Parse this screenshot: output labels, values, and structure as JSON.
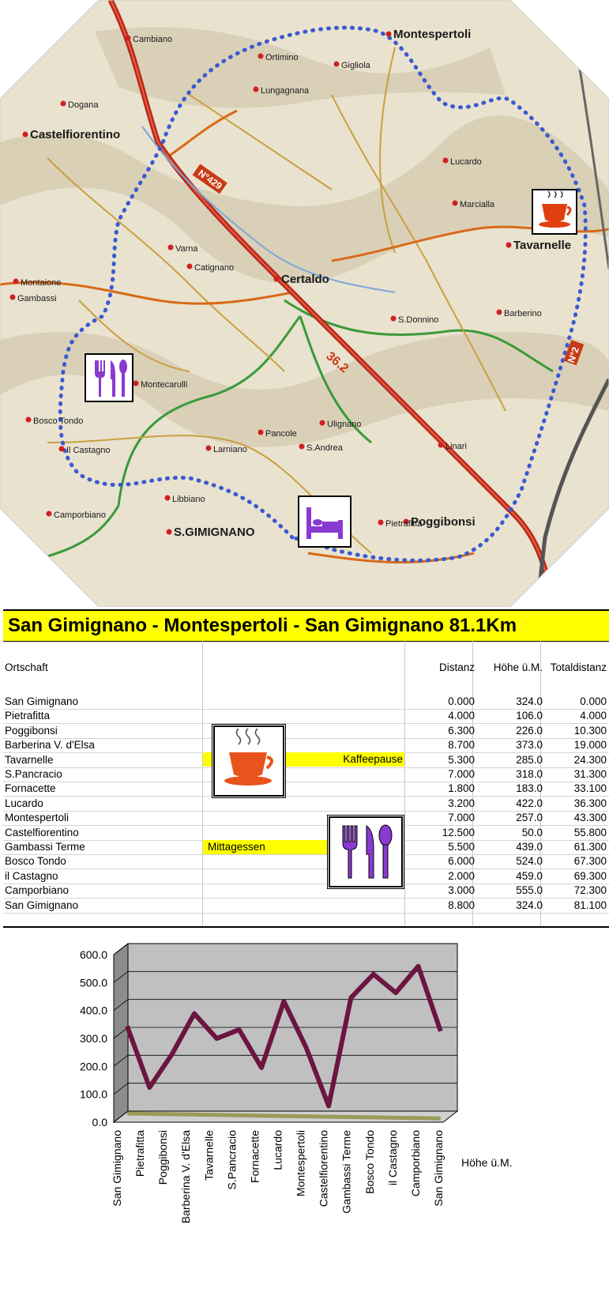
{
  "map": {
    "places": [
      {
        "name": "Castelfiorentino"
      },
      {
        "name": "Montespertoli"
      },
      {
        "name": "Certaldo"
      },
      {
        "name": "Tavarnelle"
      },
      {
        "name": "Poggibonsi"
      },
      {
        "name": "S.GIMIGNANO"
      },
      {
        "name": "Gambassi"
      },
      {
        "name": "Montaione"
      },
      {
        "name": "Barberino"
      },
      {
        "name": "Lucardo"
      },
      {
        "name": "Bosco Tondo"
      },
      {
        "name": "Camporbiano"
      },
      {
        "name": "Pietrafitta"
      },
      {
        "name": "Ortimino"
      },
      {
        "name": "Lungagnana"
      },
      {
        "name": "Gigliola"
      },
      {
        "name": "Varna"
      },
      {
        "name": "Catignano"
      },
      {
        "name": "Larniano"
      },
      {
        "name": "Libbiano"
      },
      {
        "name": "Ulignano"
      },
      {
        "name": "S.Donnino"
      },
      {
        "name": "Marcialla"
      },
      {
        "name": "Linari"
      },
      {
        "name": "Cambiano"
      },
      {
        "name": "Dogana"
      },
      {
        "name": "Il Castagno"
      },
      {
        "name": "Montecarulli"
      },
      {
        "name": "S.Andrea"
      },
      {
        "name": "Pancole"
      }
    ],
    "road_labels": [
      "N°429",
      "36.2",
      "N°2"
    ],
    "icons": {
      "coffee": "coffee-cup-icon",
      "lunch": "cutlery-icon",
      "bed": "bed-icon"
    }
  },
  "title": "San Gimignano - Montespertoli - San Gimignano 81.1Km",
  "table": {
    "headers": {
      "place": "Ortschaft",
      "dist": "Distanz",
      "height": "Höhe ü.M.",
      "total": "Totaldistanz"
    },
    "rows": [
      {
        "name": "San Gimignano",
        "dist": "0.000",
        "h": "324.0",
        "total": "0.000"
      },
      {
        "name": "Pietrafitta",
        "dist": "4.000",
        "h": "106.0",
        "total": "4.000"
      },
      {
        "name": "Poggibonsi",
        "dist": "6.300",
        "h": "226.0",
        "total": "10.300"
      },
      {
        "name": "Barberina V. d'Elsa",
        "dist": "8.700",
        "h": "373.0",
        "total": "19.000"
      },
      {
        "name": "Tavarnelle",
        "dist": "5.300",
        "h": "285.0",
        "total": "24.300"
      },
      {
        "name": "S.Pancracio",
        "dist": "7.000",
        "h": "318.0",
        "total": "31.300"
      },
      {
        "name": "Fornacette",
        "dist": "1.800",
        "h": "183.0",
        "total": "33.100"
      },
      {
        "name": "Lucardo",
        "dist": "3.200",
        "h": "422.0",
        "total": "36.300"
      },
      {
        "name": "Montespertoli",
        "dist": "7.000",
        "h": "257.0",
        "total": "43.300"
      },
      {
        "name": "Castelfiorentino",
        "dist": "12.500",
        "h": "50.0",
        "total": "55.800"
      },
      {
        "name": "Gambassi Terme",
        "dist": "5.500",
        "h": "439.0",
        "total": "61.300"
      },
      {
        "name": "Bosco Tondo",
        "dist": "6.000",
        "h": "524.0",
        "total": "67.300"
      },
      {
        "name": "il Castagno",
        "dist": "2.000",
        "h": "459.0",
        "total": "69.300"
      },
      {
        "name": "Camporbiano",
        "dist": "3.000",
        "h": "555.0",
        "total": "72.300"
      },
      {
        "name": "San Gimignano",
        "dist": "8.800",
        "h": "324.0",
        "total": "81.100"
      }
    ],
    "notes": {
      "coffee": "Kaffeepause",
      "lunch": "Mittagessen"
    }
  },
  "chart_data": {
    "type": "line",
    "categories": [
      "San Gimignano",
      "Pietrafitta",
      "Poggibonsi",
      "Barberina V. d'Elsa",
      "Tavarnelle",
      "S.Pancracio",
      "Fornacette",
      "Lucardo",
      "Montespertoli",
      "Castelfiorentino",
      "Gambassi Terme",
      "Bosco Tondo",
      "il Castagno",
      "Camporbiano",
      "San Gimignano"
    ],
    "series": [
      {
        "name": "Höhe ü.M.",
        "values": [
          324,
          106,
          226,
          373,
          285,
          318,
          183,
          422,
          257,
          50,
          439,
          524,
          459,
          555,
          324
        ]
      }
    ],
    "yticks": [
      "0.0",
      "100.0",
      "200.0",
      "300.0",
      "400.0",
      "500.0",
      "600.0"
    ],
    "ylim": [
      0,
      600
    ],
    "grid": true,
    "three_d": true,
    "line_color": "#6b1540"
  }
}
